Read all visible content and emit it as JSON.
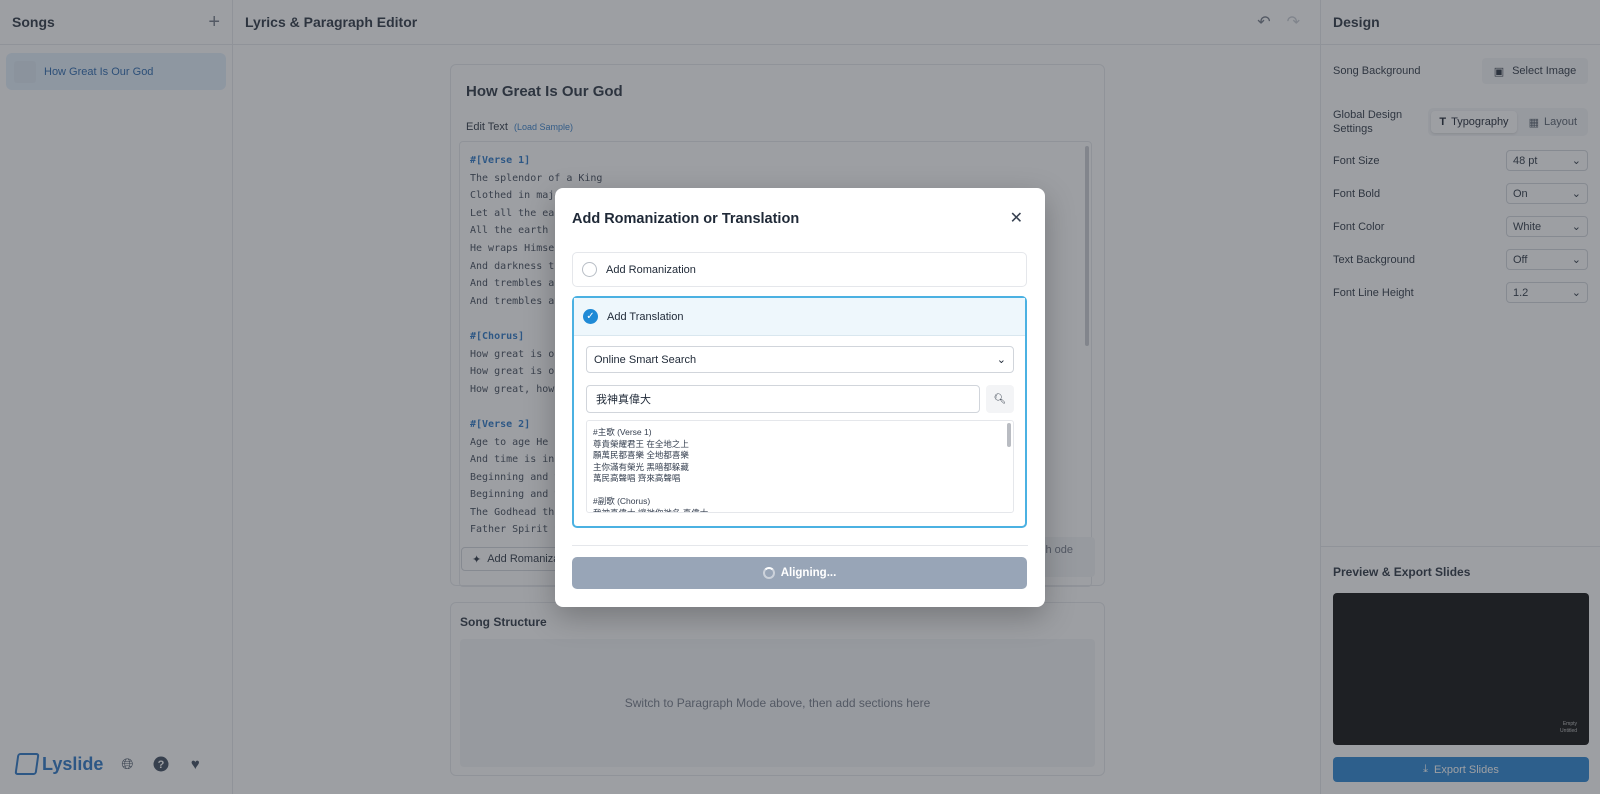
{
  "left": {
    "title": "Songs",
    "songs": [
      {
        "label": "How Great Is Our God"
      }
    ],
    "footer": {
      "logo": "Lyslide"
    }
  },
  "editor": {
    "header_title": "Lyrics & Paragraph Editor",
    "song_title": "How Great Is Our God",
    "edit_text_label": "Edit Text",
    "load_sample": "(Load Sample)",
    "lyrics": [
      "#[Verse 1]",
      "The splendor of a King",
      "Clothed in majesty",
      "Let all the earth rejoice",
      "All the earth rejoice",
      "He wraps Himself in light",
      "And darkness tries to hide",
      "And trembles at His voice",
      "And trembles at His voice",
      "",
      "#[Chorus]",
      "How great is our God",
      "How great is our God",
      "How great, how great",
      "",
      "#[Verse 2]",
      "Age to age He stands",
      "And time is in His hands",
      "Beginning and the end",
      "Beginning and the end",
      "The Godhead three in one",
      "Father Spirit Son"
    ],
    "add_rom_button": "Add Romanization",
    "paragraph_mode_button": "ragraph ode",
    "structure_title": "Song Structure",
    "structure_placeholder": "Switch to Paragraph Mode above, then add sections here"
  },
  "design": {
    "title": "Design",
    "song_background_label": "Song Background",
    "select_image": "Select Image",
    "global_label": "Global Design Settings",
    "tabs": {
      "typography": "Typography",
      "layout": "Layout"
    },
    "settings": [
      {
        "label": "Font Size",
        "value": "48 pt"
      },
      {
        "label": "Font Bold",
        "value": "On"
      },
      {
        "label": "Font Color",
        "value": "White"
      },
      {
        "label": "Text Background",
        "value": "Off"
      },
      {
        "label": "Font Line Height",
        "value": "1.2"
      }
    ],
    "preview_title": "Preview & Export Slides",
    "preview_watermark": [
      "Empty",
      "Untitled"
    ],
    "export_button": "Export Slides"
  },
  "modal": {
    "title": "Add Romanization or Translation",
    "option_romanization": "Add Romanization",
    "option_translation": "Add Translation",
    "dropdown_value": "Online Smart Search",
    "search_value": "我神真偉大",
    "results": [
      "#主歌 (Verse 1)",
      "尊貴榮耀君王 在全地之上",
      "願萬民都喜樂 全地都喜樂",
      "主你滿有榮光 黑暗都躲藏",
      "萬民高聲唱 齊來高聲唱",
      "",
      "#副歌 (Chorus)",
      "我神真偉大 讓祂你祂名 真偉大"
    ],
    "status_button": "Aligning..."
  },
  "colors": {
    "accent": "#1f7fd1",
    "selected_border": "#4bb1e2",
    "section_tag": "#1e6fc2"
  }
}
